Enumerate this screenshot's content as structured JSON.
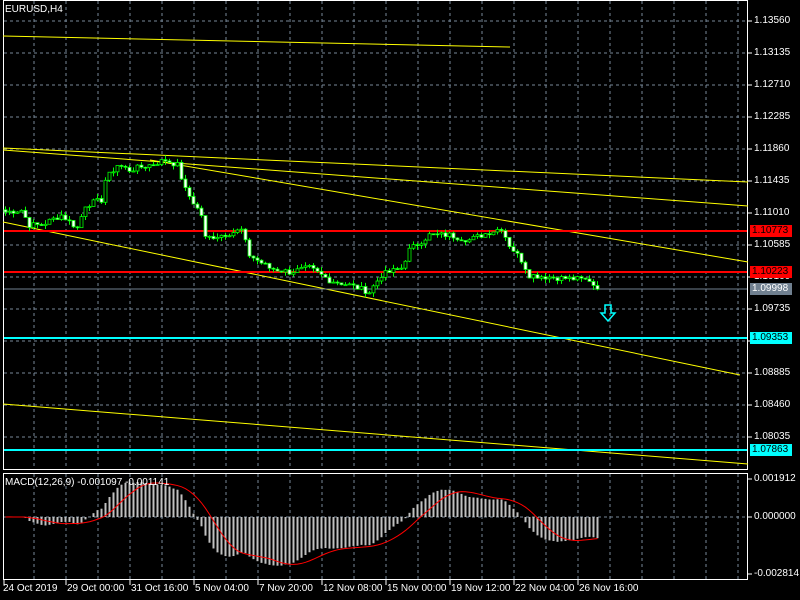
{
  "symbol_title": "EURUSD,H4",
  "colors": {
    "bg": "#000000",
    "grid": "#778899",
    "candle": "#00ff00",
    "trend": "#ffff00",
    "support_red": "#ff0000",
    "level_cyan": "#00ffff",
    "bid": "#708090",
    "macd_hist": "#c0c0c0",
    "macd_signal": "#ff0000"
  },
  "price_axis": [
    "1.13560",
    "1.13135",
    "1.12710",
    "1.12285",
    "1.11860",
    "1.11435",
    "1.11010",
    "1.10585",
    "1.10160",
    "1.09735",
    "1.09310",
    "1.08885",
    "1.08460",
    "1.08035"
  ],
  "price_tags": [
    {
      "value": "1.10773",
      "kind": "red"
    },
    {
      "value": "1.10223",
      "kind": "red"
    },
    {
      "value": "1.09998",
      "kind": "bid"
    },
    {
      "value": "1.09353",
      "kind": "cyan"
    },
    {
      "value": "1.07863",
      "kind": "cyan"
    }
  ],
  "time_axis": [
    "24 Oct 2019",
    "29 Oct 00:00",
    "31 Oct 16:00",
    "5 Nov 04:00",
    "7 Nov 20:00",
    "12 Nov 08:00",
    "15 Nov 00:00",
    "19 Nov 12:00",
    "22 Nov 04:00",
    "26 Nov 16:00"
  ],
  "macd": {
    "label": "MACD(12,26,9) -0.001097 -0.001141",
    "axis": [
      "0.001912",
      "0.000000",
      "-0.002814"
    ]
  },
  "price_path": [
    [
      0,
      1.11024
    ],
    [
      4,
      1.1105
    ],
    [
      6,
      1.10851
    ],
    [
      9,
      1.10851
    ],
    [
      14,
      1.10984
    ],
    [
      18,
      1.10811
    ],
    [
      20,
      1.11116
    ],
    [
      24,
      1.11183
    ],
    [
      25,
      1.11449
    ],
    [
      28,
      1.11648
    ],
    [
      31,
      1.11581
    ],
    [
      36,
      1.11648
    ],
    [
      40,
      1.11714
    ],
    [
      43,
      1.11648
    ],
    [
      45,
      1.11316
    ],
    [
      49,
      1.10984
    ],
    [
      50,
      1.10678
    ],
    [
      54,
      1.10718
    ],
    [
      59,
      1.10784
    ],
    [
      61,
      1.10452
    ],
    [
      66,
      1.1028
    ],
    [
      71,
      1.10227
    ],
    [
      76,
      1.1028
    ],
    [
      81,
      1.1012
    ],
    [
      86,
      1.10054
    ],
    [
      91,
      1.09961
    ],
    [
      94,
      1.10187
    ],
    [
      99,
      1.1028
    ],
    [
      101,
      1.10519
    ],
    [
      106,
      1.10718
    ],
    [
      111,
      1.10718
    ],
    [
      116,
      1.10652
    ],
    [
      121,
      1.10758
    ],
    [
      124,
      1.10811
    ],
    [
      126,
      1.10585
    ],
    [
      129,
      1.10386
    ],
    [
      131,
      1.10187
    ],
    [
      139,
      1.10147
    ],
    [
      146,
      1.1012
    ],
    [
      148,
      1.09998
    ]
  ],
  "signal_arrow": "down-arrow"
}
